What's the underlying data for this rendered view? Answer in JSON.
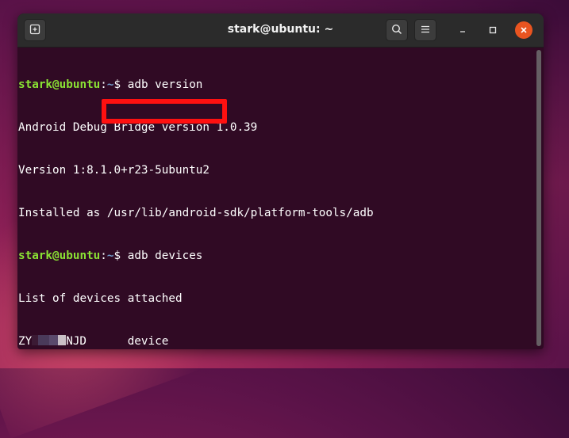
{
  "window": {
    "title": "stark@ubuntu: ~",
    "controls": {
      "minimize_icon": "minimize-icon",
      "maximize_icon": "maximize-icon",
      "close_icon": "close-icon"
    }
  },
  "toolbar": {
    "new_tab_icon": "new-tab-icon",
    "search_icon": "search-icon",
    "menu_icon": "hamburger-menu-icon"
  },
  "colors": {
    "terminal_bg": "#300a24",
    "prompt_user": "#8ae234",
    "prompt_path": "#729fcf",
    "highlight": "#ff1010",
    "close_button": "#e95420"
  },
  "terminal": {
    "prompt_user": "stark@ubuntu",
    "prompt_sep": ":",
    "prompt_path": "~",
    "prompt_char": "$",
    "cmd1": " adb version",
    "out1": "Android Debug Bridge version 1.0.39",
    "out2": "Version 1:8.1.0+r23-5ubuntu2",
    "out3": "Installed as /usr/lib/android-sdk/platform-tools/adb",
    "cmd2": " adb devices",
    "out4": "List of devices attached",
    "device_serial_prefix": "ZY",
    "device_serial_suffix": "NJD",
    "device_state": "device",
    "cmd3": ""
  }
}
